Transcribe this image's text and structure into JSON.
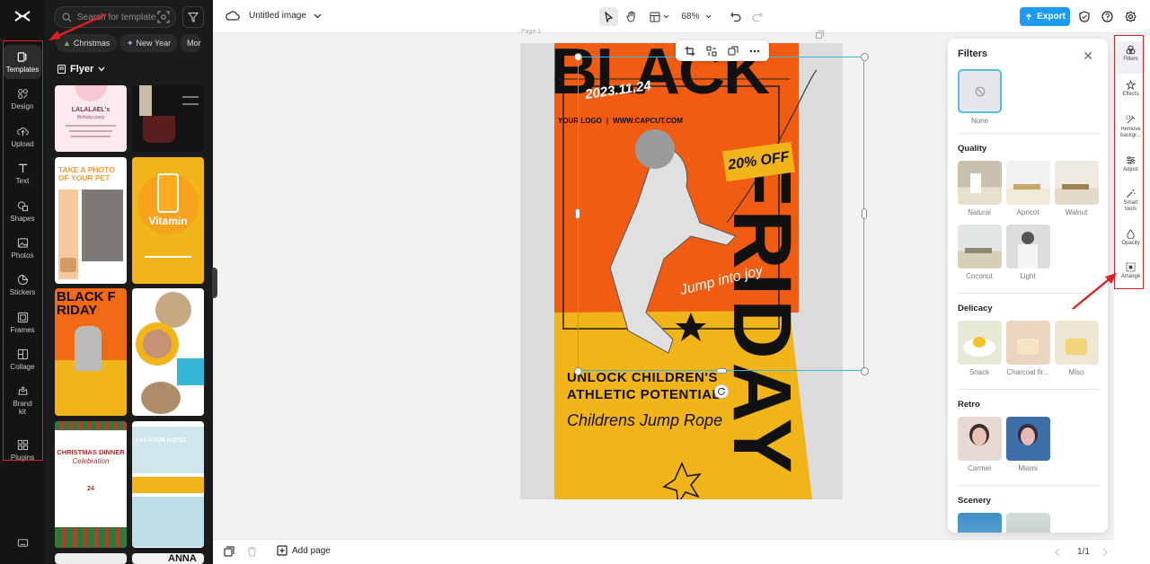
{
  "left_rail": {
    "items": [
      {
        "label": "Templates",
        "icon": "templates-icon"
      },
      {
        "label": "Design",
        "icon": "design-icon"
      },
      {
        "label": "Upload",
        "icon": "upload-icon"
      },
      {
        "label": "Text",
        "icon": "text-icon"
      },
      {
        "label": "Shapes",
        "icon": "shapes-icon"
      },
      {
        "label": "Photos",
        "icon": "photos-icon"
      },
      {
        "label": "Stickers",
        "icon": "stickers-icon"
      },
      {
        "label": "Frames",
        "icon": "frames-icon"
      },
      {
        "label": "Collage",
        "icon": "collage-icon"
      },
      {
        "label": "Brand\nkit",
        "icon": "brand-kit-icon"
      },
      {
        "label": "Plugins",
        "icon": "plugins-icon"
      }
    ]
  },
  "template_panel": {
    "search_placeholder": "Search for templates",
    "chips": [
      "Christmas",
      "New Year",
      "Mor"
    ],
    "category": "Flyer",
    "thumbs": {
      "lala_title": "LALALAEL's",
      "lala_sub": "Birthday party",
      "pet_title": "TAKE A PHOTO OF YOUR PET",
      "vitamin_title": "Vitamin",
      "black_friday_title": "BLACK FRIDAY",
      "christmas_title": "CHRISTMAS DINNER",
      "christmas_sub": "Celebration",
      "christmas_date": "24",
      "vacation_title": "VACATION HOTEL",
      "anna_title": "ANNA"
    }
  },
  "topbar": {
    "title": "Untitled image",
    "zoom": "68%",
    "export_label": "Export"
  },
  "canvas": {
    "page_label": "Page 1",
    "poster": {
      "headline_top": "BLACK",
      "headline_side": "FRIDAY",
      "date": "2023.11.24",
      "logo": "YOUR LOGO",
      "website": "WWW.CAPCUT.COM",
      "discount": "20% OFF",
      "tagline": "Jump into joy",
      "slogan_line1": "UNLOCK CHILDREN'S",
      "slogan_line2": "ATHLETIC POTENTIAL!",
      "product": "Childrens Jump Rope"
    }
  },
  "bottombar": {
    "add_page": "Add page",
    "page_count": "1/1"
  },
  "filters_panel": {
    "title": "Filters",
    "none_label": "None",
    "sections": [
      {
        "title": "Quality",
        "items": [
          "Natural",
          "Apricot",
          "Walnut",
          "Coconut",
          "Light"
        ]
      },
      {
        "title": "Delicacy",
        "items": [
          "Snack",
          "Charcoal fir...",
          "Miso"
        ]
      },
      {
        "title": "Retro",
        "items": [
          "Carmel",
          "Miami"
        ]
      },
      {
        "title": "Scenery",
        "items": []
      }
    ]
  },
  "right_rail": {
    "items": [
      {
        "label": "Filters",
        "icon": "filters-icon"
      },
      {
        "label": "Effects",
        "icon": "effects-icon"
      },
      {
        "label": "Remove backgr...",
        "icon": "remove-background-icon"
      },
      {
        "label": "Adjust",
        "icon": "adjust-icon"
      },
      {
        "label": "Smart tools",
        "icon": "smart-tools-icon"
      },
      {
        "label": "Opacity",
        "icon": "opacity-icon"
      },
      {
        "label": "Arrange",
        "icon": "arrange-icon"
      }
    ]
  },
  "colors": {
    "accent": "#1d9bf0",
    "selection": "#3bb6d8",
    "annotation_red": "#e02020",
    "poster_orange": "#f25b12",
    "poster_yellow": "#f2b519"
  }
}
